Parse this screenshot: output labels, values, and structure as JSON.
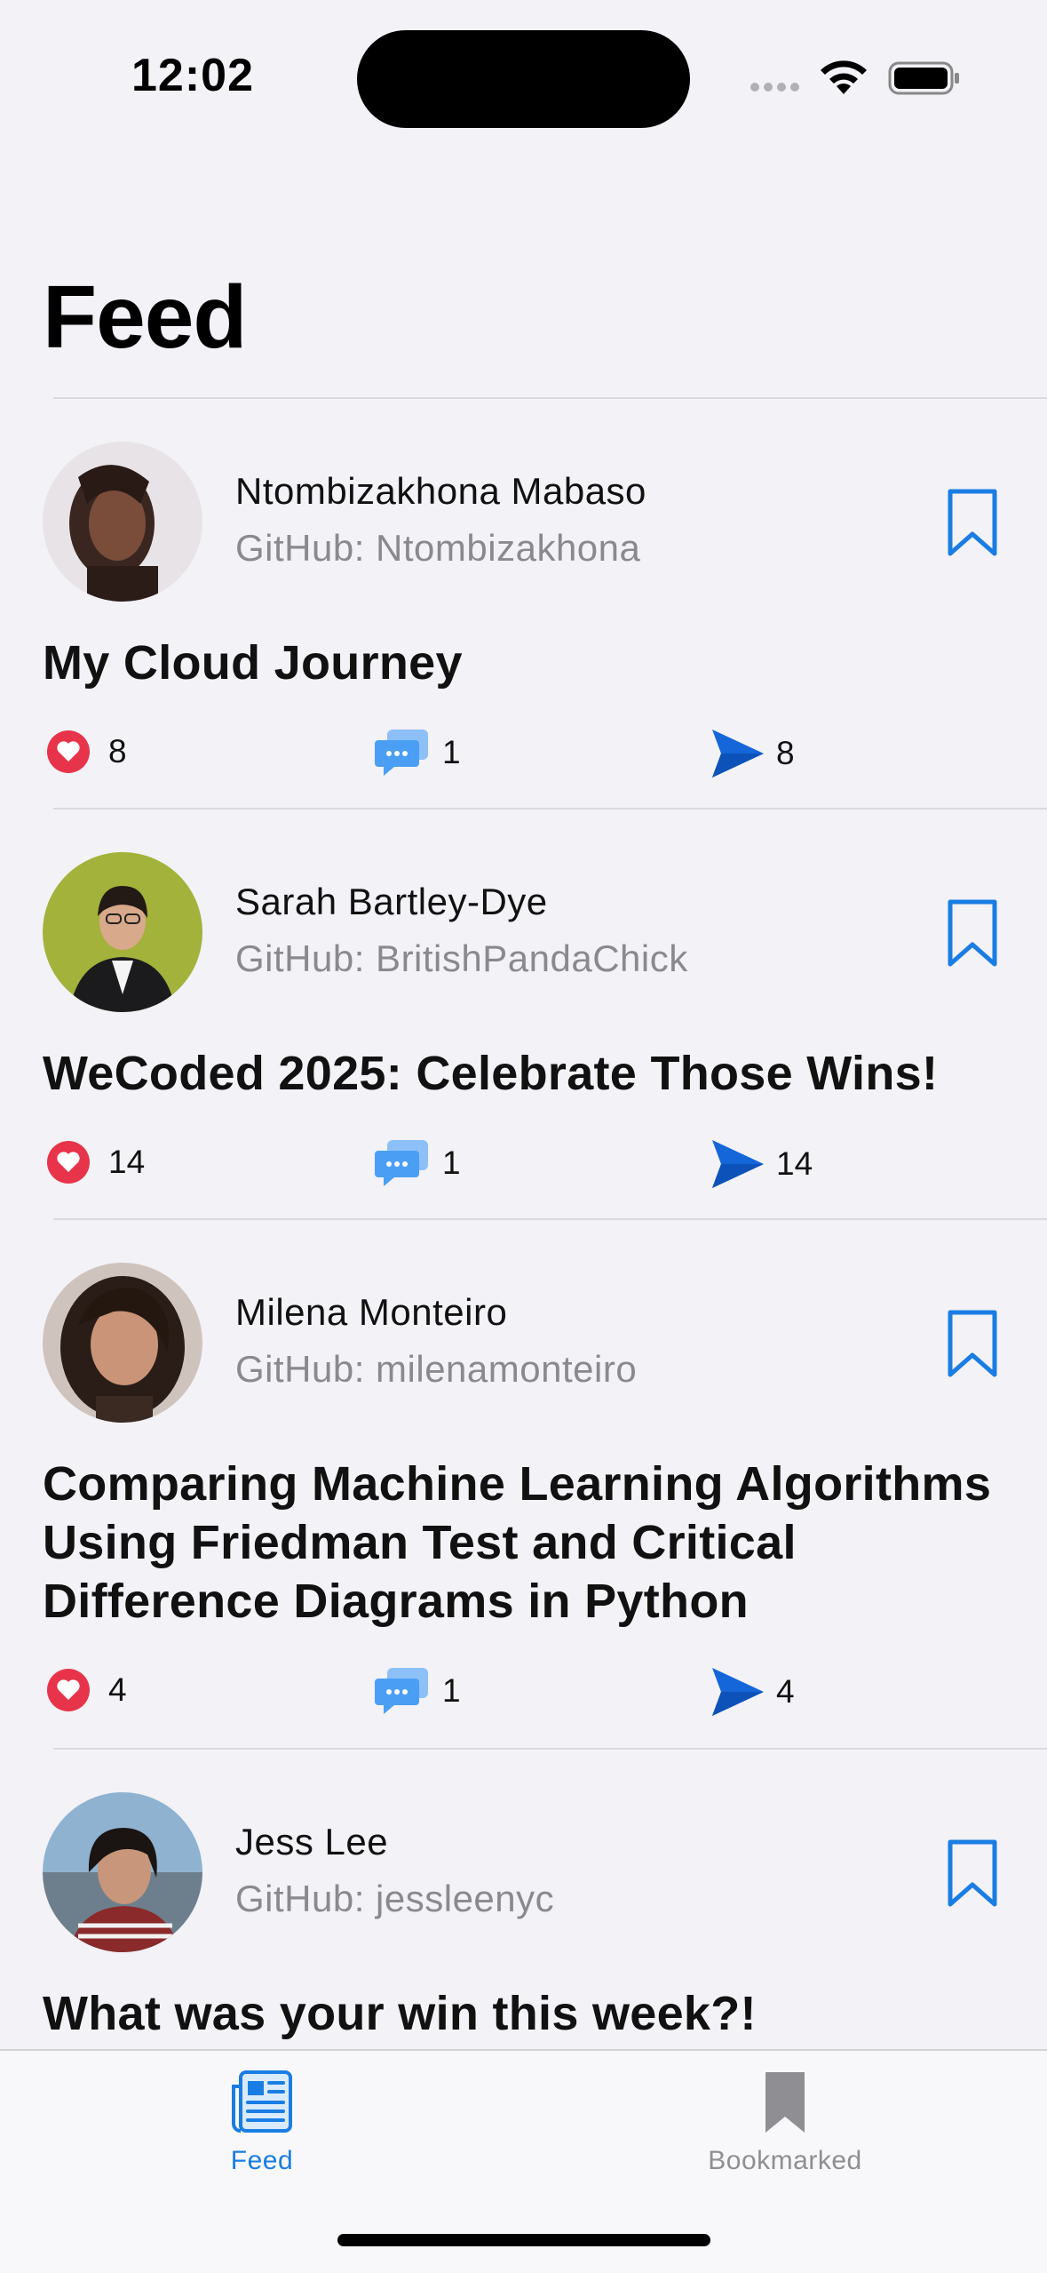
{
  "status_bar": {
    "time": "12:02"
  },
  "header": {
    "title": "Feed"
  },
  "posts": [
    {
      "author": "Ntombizakhona Mabaso",
      "github": "GitHub: Ntombizakhona",
      "title": "My Cloud Journey",
      "likes": "8",
      "comments": "1",
      "shares": "8"
    },
    {
      "author": "Sarah Bartley-Dye",
      "github": "GitHub: BritishPandaChick",
      "title": "WeCoded 2025: Celebrate Those Wins!",
      "likes": "14",
      "comments": "1",
      "shares": "14"
    },
    {
      "author": "Milena Monteiro",
      "github": "GitHub: milenamonteiro",
      "title": "Comparing Machine Learning Algorithms Using Friedman Test and Critical Difference Diagrams in Python",
      "likes": "4",
      "comments": "1",
      "shares": "4"
    },
    {
      "author": "Jess Lee",
      "github": "GitHub: jessleenyc",
      "title": "What was your win this week?!"
    }
  ],
  "tab_bar": {
    "tabs": [
      {
        "label": "Feed",
        "icon": "newspaper-icon",
        "selected": true
      },
      {
        "label": "Bookmarked",
        "icon": "bookmark-icon",
        "selected": false
      }
    ]
  },
  "colors": {
    "accent": "#1a7de3",
    "like": "#e8344a",
    "comment": "#4a9ff5",
    "share": "#1466d9",
    "muted": "#8a8a8e",
    "background": "#f2f2f7"
  }
}
